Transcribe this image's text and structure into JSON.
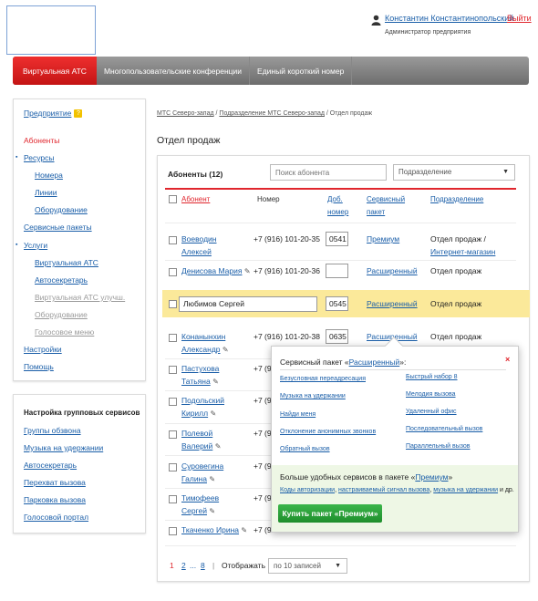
{
  "header": {
    "user_name": "Константин Константинопольский",
    "logout": "Выйти",
    "user_role": "Администратор предприятия"
  },
  "topnav": {
    "tabs": [
      "Виртуальная АТС",
      "Многопользовательские конференции",
      "Единый короткий номер"
    ]
  },
  "sidebar": {
    "enterprise": "Предприятие",
    "enterprise_badge": "?",
    "items": [
      "Абоненты",
      "Ресурсы",
      "Номера",
      "Линии",
      "Оборудование",
      "Сервисные пакеты",
      "Услуги",
      "Виртуальная АТС",
      "Автосекретарь",
      "Виртуальная АТС улучш.",
      "Оборудование",
      "Голосовое меню",
      "Настройки",
      "Помощь"
    ]
  },
  "group_services": {
    "title": "Настройка групповых сервисов",
    "items": [
      "Группы обзвона",
      "Музыка на удержании",
      "Автосекретарь",
      "Перехват вызова",
      "Парковка вызова",
      "Голосовой портал"
    ]
  },
  "breadcrumb": {
    "items": [
      "МТС Северо-запад",
      "Подразделение МТС Северо-запад",
      "Отдел продаж"
    ],
    "sep": " / "
  },
  "page_title": "Отдел продаж",
  "table": {
    "title": "Абоненты (12)",
    "search_placeholder": "Поиск абонента",
    "dept_select": "Подразделение",
    "headers": {
      "abonent": "Абонент",
      "number": "Номер",
      "ext_1": "Доб.",
      "ext_2": "номер",
      "pkg_1": "Сервисный",
      "pkg_2": "пакет",
      "dept": "Подразделение"
    },
    "rows": [
      {
        "name1": "Воеводин",
        "name2": "Алексей",
        "number": "+7 (916) 101-20-35",
        "ext": "0541",
        "pkg": "Премиум",
        "dept1": "Отдел продаж /",
        "dept2": "Интернет-магазин"
      },
      {
        "name1": "Денисова Мария",
        "number": "+7 (916) 101-20-36",
        "ext": "",
        "pkg": "Расширенный",
        "dept1": "Отдел продаж"
      },
      {
        "name1": "Любимов Сергей",
        "ext": "0545",
        "pkg": "Расширенный",
        "dept1": "Отдел продаж"
      },
      {
        "name1": "Конанынхин",
        "name2": "Александр",
        "number": "+7 (916) 101-20-38",
        "ext": "0635",
        "pkg": "Расширенный",
        "dept1": "Отдел продаж"
      },
      {
        "name1": "Пастухова",
        "name2": "Татьяна",
        "number": "+7 (9"
      },
      {
        "name1": "Подольский",
        "name2": "Кирилл",
        "number": "+7 (9"
      },
      {
        "name1": "Полевой",
        "name2": "Валерий",
        "number": "+7 (9"
      },
      {
        "name1": "Суровегина",
        "name2": "Галина",
        "number": "+7 (9"
      },
      {
        "name1": "Тимофеев",
        "name2": "Сергей",
        "number": "+7 (9"
      },
      {
        "name1": "Ткаченко Ирина",
        "number": "+7 (9"
      }
    ]
  },
  "popup": {
    "title_prefix": "Сервисный пакет «",
    "title_link": "Расширенный",
    "title_suffix": "»:",
    "close": "×",
    "services_left": [
      "Безусловная переадресация",
      "Музыка на удержании",
      "Найди меня",
      "Отклонение анонимных звонков",
      "Обратный вызов"
    ],
    "services_right": [
      "Быстрый набор 8",
      "Мелодия вызова",
      "Удаленный офис",
      "Последовательный вызов",
      "Параллельный вызов"
    ],
    "promo_prefix": "Больше удобных сервисов в пакете «",
    "promo_link": "Премиум",
    "promo_suffix": "»",
    "promo_links": [
      "Коды авторизации",
      "настраиваемый сигнал вызова",
      "музыка на удержании"
    ],
    "promo_sep": ", ",
    "promo_tail": " и др.",
    "buy_button": "Купить пакет «Премиум»"
  },
  "pagination": {
    "current": "1",
    "page2": "2",
    "dots": "...",
    "last": "8",
    "sep": "|",
    "show_label": "Отображать",
    "per_page": "по 10 записей"
  },
  "colors": {
    "accent": "#e0262d",
    "link": "#1a5ea8",
    "highlight": "#fbe99a",
    "buy": "#2aa23a"
  }
}
